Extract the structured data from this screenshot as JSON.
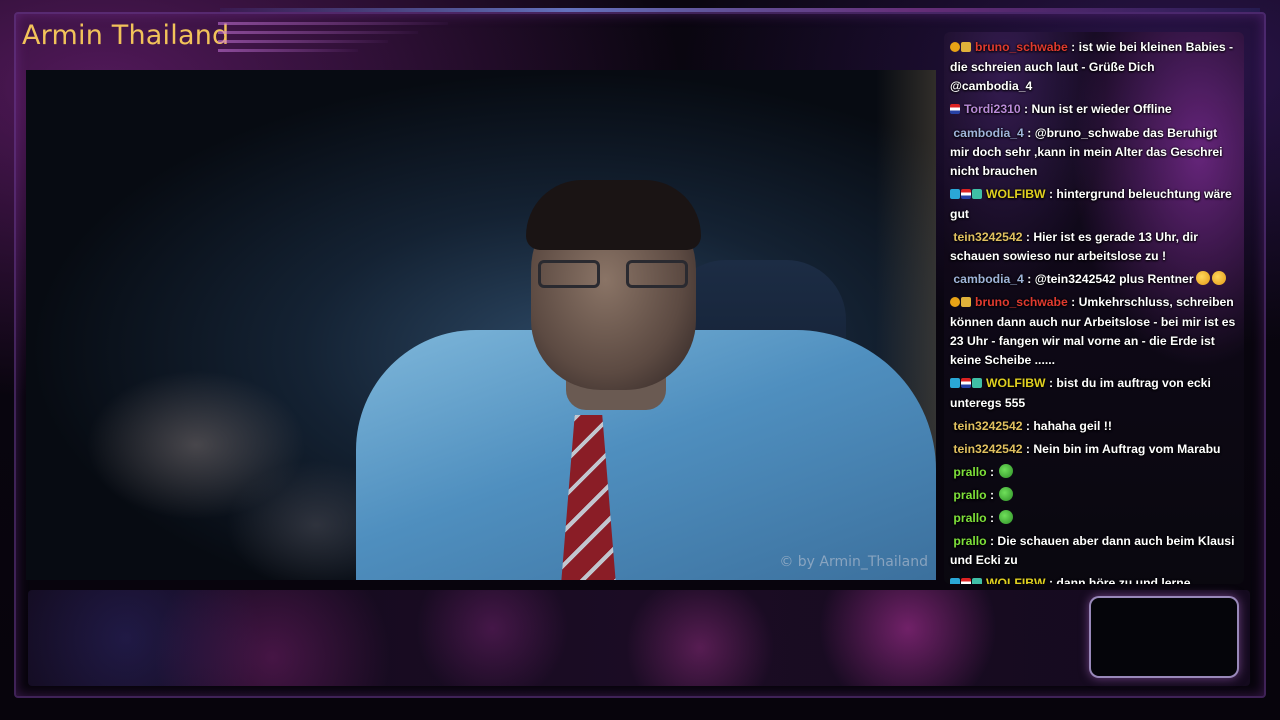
{
  "overlay": {
    "channel_title": "Armin Thailand",
    "watermark": "© by Armin_Thailand"
  },
  "chat": {
    "messages": [
      {
        "user": "bruno_schwabe",
        "user_color": "#e03a2f",
        "badges": [
          "warn-badge",
          "crown-badge"
        ],
        "text": "ist wie bei kleinen Babies - die schreien auch laut - Grüße Dich @cambodia_4",
        "emotes": []
      },
      {
        "user": "Tordi2310",
        "user_color": "#b98ad8",
        "badges": [
          "flag-badge"
        ],
        "text": "Nun ist er wieder Offline",
        "emotes": []
      },
      {
        "user": "cambodia_4",
        "user_color": "#9fb4d9",
        "badges": [],
        "text": "@bruno_schwabe das Beruhigt mir doch sehr ,kann in mein Alter das Geschrei nicht brauchen",
        "emotes": []
      },
      {
        "user": "WOLFIBW",
        "user_color": "#e0d020",
        "badges": [
          "sub-badge",
          "flag-badge",
          "gift-badge"
        ],
        "text": "hintergrund beleuchtung wäre gut",
        "emotes": []
      },
      {
        "user": "tein3242542",
        "user_color": "#e0c060",
        "badges": [],
        "text": "Hier ist es gerade 13 Uhr, dir schauen sowieso nur arbeitslose zu !",
        "emotes": []
      },
      {
        "user": "cambodia_4",
        "user_color": "#9fb4d9",
        "badges": [],
        "text": "@tein3242542 plus Rentner",
        "emotes": [
          "smile-emote",
          "smile-emote"
        ]
      },
      {
        "user": "bruno_schwabe",
        "user_color": "#e03a2f",
        "badges": [
          "warn-badge",
          "crown-badge"
        ],
        "text": "Umkehrschluss, schreiben können dann auch nur Arbeitslose - bei mir ist es 23 Uhr - fangen wir mal vorne an - die Erde ist keine Scheibe ......",
        "emotes": []
      },
      {
        "user": "WOLFIBW",
        "user_color": "#e0d020",
        "badges": [
          "sub-badge",
          "flag-badge",
          "gift-badge"
        ],
        "text": "bist du im auftrag von ecki unteregs 555",
        "emotes": []
      },
      {
        "user": "tein3242542",
        "user_color": "#e0c060",
        "badges": [],
        "text": "hahaha geil !!",
        "emotes": []
      },
      {
        "user": "tein3242542",
        "user_color": "#e0c060",
        "badges": [],
        "text": "Nein bin im Auftrag vom Marabu",
        "emotes": []
      },
      {
        "user": "prallo",
        "user_color": "#7ee03a",
        "badges": [],
        "text": "",
        "emotes": [
          "frog-emote"
        ]
      },
      {
        "user": "prallo",
        "user_color": "#7ee03a",
        "badges": [],
        "text": "",
        "emotes": [
          "frog-emote"
        ]
      },
      {
        "user": "prallo",
        "user_color": "#7ee03a",
        "badges": [],
        "text": "",
        "emotes": [
          "frog-emote"
        ]
      },
      {
        "user": "prallo",
        "user_color": "#7ee03a",
        "badges": [],
        "text": "Die schauen aber dann auch beim Klausi und Ecki zu",
        "emotes": []
      },
      {
        "user": "WOLFIBW",
        "user_color": "#e0d020",
        "badges": [
          "sub-badge",
          "flag-badge",
          "gift-badge"
        ],
        "text": "dann höre zu und lerne",
        "emotes": []
      }
    ],
    "separator": " : "
  },
  "colors": {
    "title": "#f2c35a",
    "accent_purple": "#a040c0"
  }
}
